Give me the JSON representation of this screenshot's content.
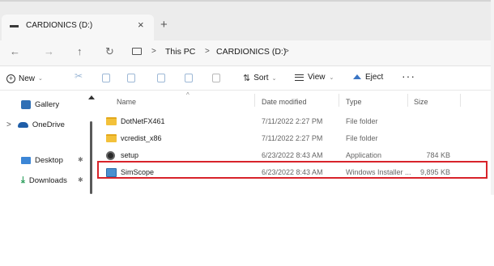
{
  "tab": {
    "title": "CARDIONICS (D:)",
    "close_glyph": "×",
    "new_glyph": "+"
  },
  "address": {
    "back_glyph": "←",
    "forward_glyph": "→",
    "up_glyph": "↑",
    "refresh_glyph": "↻",
    "separator": ">",
    "crumbs": [
      "This PC",
      "CARDIONICS (D:)"
    ]
  },
  "commandbar": {
    "new_label": "New",
    "sort_label": "Sort",
    "view_label": "View",
    "eject_label": "Eject",
    "more_label": "···",
    "caret": "⌄"
  },
  "sidebar": {
    "items": [
      {
        "label": "Gallery",
        "icon": "gallery-icon"
      },
      {
        "label": "OneDrive",
        "icon": "onedrive-icon"
      },
      {
        "label": "Desktop",
        "icon": "desktop-icon",
        "pinned": true
      },
      {
        "label": "Downloads",
        "icon": "downloads-icon",
        "pinned": true
      }
    ],
    "pin_glyph": "✱"
  },
  "columns": {
    "name": "Name",
    "date": "Date modified",
    "type": "Type",
    "size": "Size"
  },
  "files": [
    {
      "name": "DotNetFX461",
      "date": "7/11/2022 2:27 PM",
      "type": "File folder",
      "size": "",
      "icon": "folder-icon"
    },
    {
      "name": "vcredist_x86",
      "date": "7/11/2022 2:27 PM",
      "type": "File folder",
      "size": "",
      "icon": "folder-icon"
    },
    {
      "name": "setup",
      "date": "6/23/2022 8:43 AM",
      "type": "Application",
      "size": "784 KB",
      "icon": "application-icon"
    },
    {
      "name": "SimScope",
      "date": "6/23/2022 8:43 AM",
      "type": "Windows Installer ...",
      "size": "9,895 KB",
      "icon": "installer-icon",
      "highlighted": true
    }
  ],
  "colors": {
    "highlight": "#d8232a",
    "accent": "#3a75c4",
    "folder": "#f3c13a"
  }
}
